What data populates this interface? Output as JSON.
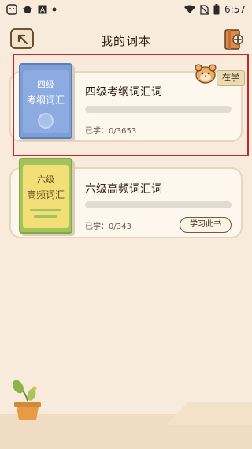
{
  "status_bar": {
    "time": "6:57",
    "left_icons": [
      "app-icon",
      "bug-icon",
      "alert-icon",
      "dot-icon"
    ],
    "right_icons": [
      "wifi-icon",
      "sim-off-icon",
      "battery-icon"
    ]
  },
  "header": {
    "title": "我的词本"
  },
  "books": [
    {
      "cover_line1": "四级",
      "cover_line2": "考纲词汇",
      "title": "四级考纲词汇词",
      "learned": "已学：0/3653",
      "progress": 0,
      "badge": "在学"
    },
    {
      "cover_line1": "六级",
      "cover_line2": "高频词汇",
      "title": "六级高频词汇词",
      "learned": "已学：0/343",
      "progress": 0,
      "action": "学习此书"
    }
  ],
  "colors": {
    "background": "#f8ebdb",
    "card": "#fdf7ee",
    "book1_cover": "#7d9ed6",
    "book2_cover": "#f3df78",
    "highlight": "#c4282c"
  }
}
